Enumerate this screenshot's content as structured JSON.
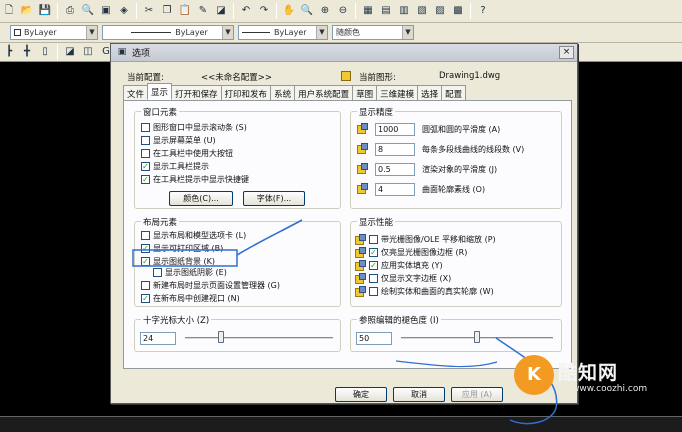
{
  "toolbar3": {
    "frame_label": "G"
  },
  "layer_bar": {
    "layer_combo": "ByLayer",
    "linetype_combo": "ByLayer",
    "lineweight_combo": "ByLayer",
    "color_combo": "随颜色"
  },
  "dialog": {
    "title": "选项",
    "close_label": "×",
    "current_profile_label": "当前配置:",
    "current_profile_value": "<<未命名配置>>",
    "current_drawing_label": "当前图形:",
    "current_drawing_value": "Drawing1.dwg",
    "tabs": [
      {
        "label": "文件"
      },
      {
        "label": "显示"
      },
      {
        "label": "打开和保存"
      },
      {
        "label": "打印和发布"
      },
      {
        "label": "系统"
      },
      {
        "label": "用户系统配置"
      },
      {
        "label": "草图"
      },
      {
        "label": "三维建模"
      },
      {
        "label": "选择"
      },
      {
        "label": "配置"
      }
    ],
    "window_elements": {
      "title": "窗口元素",
      "items": [
        {
          "label": "图形窗口中显示滚动条 (S)",
          "checked": false
        },
        {
          "label": "显示屏幕菜单 (U)",
          "checked": false
        },
        {
          "label": "在工具栏中使用大按钮",
          "checked": false
        },
        {
          "label": "显示工具栏提示",
          "checked": true
        },
        {
          "label": "在工具栏提示中显示快捷键",
          "checked": true
        }
      ],
      "colors_button": "颜色(C)...",
      "fonts_button": "字体(F)..."
    },
    "display_resolution": {
      "title": "显示精度",
      "items": [
        {
          "value": "1000",
          "label": "圆弧和圆的平滑度 (A)"
        },
        {
          "value": "8",
          "label": "每条多段线曲线的线段数 (V)"
        },
        {
          "value": "0.5",
          "label": "渲染对象的平滑度 (J)"
        },
        {
          "value": "4",
          "label": "曲面轮廓素线 (O)"
        }
      ]
    },
    "layout_elements": {
      "title": "布局元素",
      "items": [
        {
          "label": "显示布局和模型选项卡 (L)",
          "checked": false
        },
        {
          "label": "显示可打印区域 (B)",
          "checked": true
        },
        {
          "label": "显示图纸背景 (K)",
          "checked": true
        },
        {
          "label": "显示图纸阴影 (E)",
          "checked": false
        },
        {
          "label": "新建布局时显示页面设置管理器 (G)",
          "checked": false
        },
        {
          "label": "在新布局中创建视口 (N)",
          "checked": true
        }
      ]
    },
    "display_performance": {
      "title": "显示性能",
      "items": [
        {
          "label": "带光栅图像/OLE 平移和缩放 (P)",
          "checked": false
        },
        {
          "label": "仅亮显光栅图像边框 (R)",
          "checked": true
        },
        {
          "label": "应用实体填充 (Y)",
          "checked": true
        },
        {
          "label": "仅显示文字边框 (X)",
          "checked": false
        },
        {
          "label": "绘制实体和曲面的真实轮廓 (W)",
          "checked": false
        }
      ]
    },
    "crosshair_size": {
      "title": "十字光标大小 (Z)",
      "value": "24",
      "fraction": 0.24
    },
    "reference_fade": {
      "title": "参照编辑的褪色度 (I)",
      "value": "50",
      "fraction": 0.5
    },
    "buttons": {
      "ok": "确定",
      "cancel": "取消",
      "apply": "应用 (A)"
    }
  },
  "watermark": {
    "logo_letter": "K",
    "name": "酷知网",
    "url": "www.coozhi.com"
  },
  "colors": {
    "dialog_bg": "#ece9d8",
    "panel_bg": "#fcfcfe",
    "drawing_bg": "#000000",
    "annotation": "#2f6fd0"
  }
}
